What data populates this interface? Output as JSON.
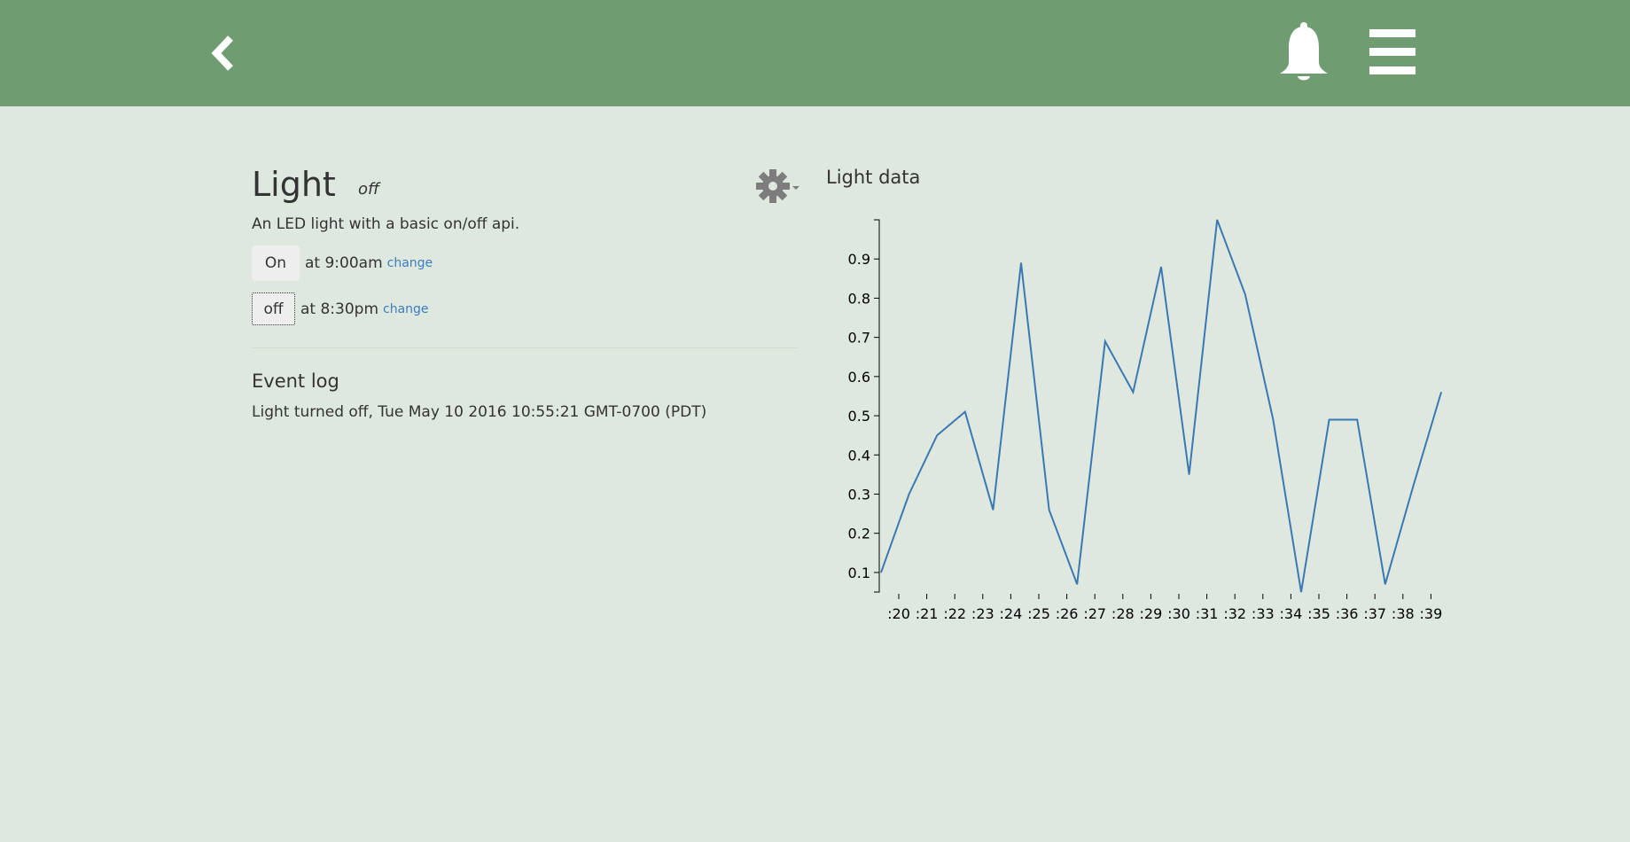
{
  "header": {
    "background": "#6f9c71",
    "back_icon": "chevron-left-icon",
    "notification_icon": "bell-icon",
    "menu_icon": "hamburger-menu-icon"
  },
  "device": {
    "title": "Light",
    "state": "off",
    "description": "An LED light with a basic on/off api.",
    "settings_icon": "gear-icon"
  },
  "schedule": [
    {
      "button_label": "On",
      "time_text": "at 9:00am",
      "change_label": "change"
    },
    {
      "button_label": "off",
      "time_text": "at 8:30pm",
      "change_label": "change"
    }
  ],
  "event_log": {
    "title": "Event log",
    "entries": [
      "Light turned off, Tue May 10 2016 10:55:21 GMT-0700 (PDT)"
    ]
  },
  "chart_title": "Light data",
  "chart_data": {
    "type": "line",
    "title": "Light data",
    "xlabel": "",
    "ylabel": "",
    "line_color": "#3a78b4",
    "x": [
      ":19.8",
      ":20.8",
      ":21.8",
      ":22.8",
      ":23.8",
      ":24.8",
      ":25.8",
      ":26.8",
      ":27.8",
      ":28.8",
      ":29.8",
      ":30.8",
      ":31.8",
      ":32.8",
      ":33.8",
      ":34.8",
      ":35.8",
      ":36.8",
      ":37.8",
      ":38.8",
      ":39.8"
    ],
    "values": [
      0.1,
      0.3,
      0.45,
      0.51,
      0.26,
      0.89,
      0.26,
      0.07,
      0.69,
      0.56,
      0.88,
      0.35,
      1.0,
      0.81,
      0.49,
      0.05,
      0.49,
      0.49,
      0.07,
      0.32,
      0.56
    ],
    "x_ticks": [
      ":20",
      ":21",
      ":22",
      ":23",
      ":24",
      ":25",
      ":26",
      ":27",
      ":28",
      ":29",
      ":30",
      ":31",
      ":32",
      ":33",
      ":34",
      ":35",
      ":36",
      ":37",
      ":38",
      ":39"
    ],
    "y_ticks": [
      "0.1",
      "0.2",
      "0.3",
      "0.4",
      "0.5",
      "0.6",
      "0.7",
      "0.8",
      "0.9"
    ],
    "ylim": [
      0.05,
      1.0
    ],
    "grid": false,
    "legend": "none"
  }
}
